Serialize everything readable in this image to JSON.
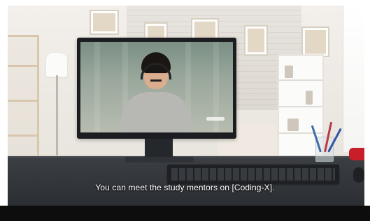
{
  "caption": {
    "text": "You can meet the study mentors on [Coding-X]."
  },
  "colors": {
    "desk": "#2f3237",
    "accent_red": "#c81e2a",
    "bottom_bar": "#0d0d0d"
  }
}
